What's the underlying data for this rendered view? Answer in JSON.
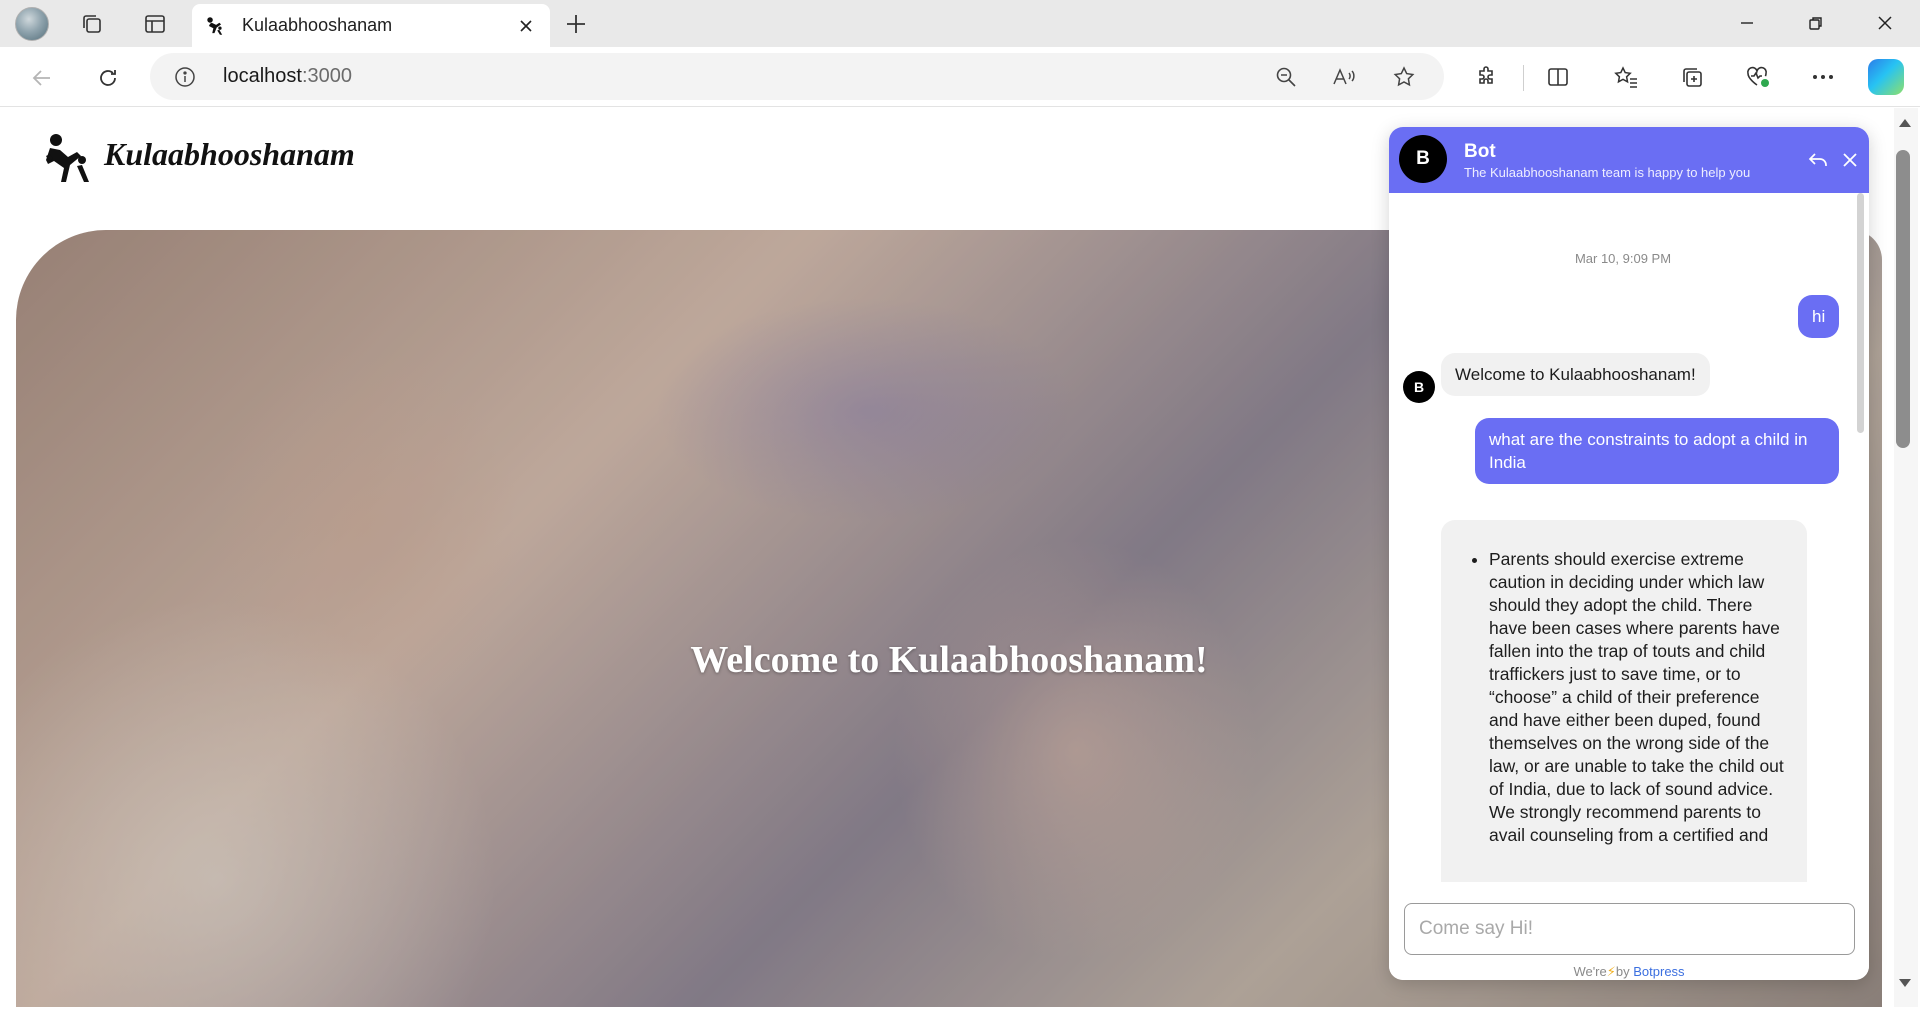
{
  "browser": {
    "tab_title": "Kulaabhooshanam",
    "url_host": "localhost",
    "url_port": ":3000"
  },
  "site": {
    "title": "Kulaabhooshanam",
    "hero_heading": "Welcome to Kulaabhooshanam!"
  },
  "chat": {
    "bot_initial": "B",
    "bot_name": "Bot",
    "bot_description": "The Kulaabhooshanam team is happy to help you",
    "timestamp": "Mar 10, 9:09 PM",
    "messages": [
      {
        "from": "user",
        "text": "hi"
      },
      {
        "from": "bot",
        "text": "Welcome to Kulaabhooshanam!"
      },
      {
        "from": "user",
        "text": "what are the constraints to adopt a child in India"
      },
      {
        "from": "bot",
        "text": "Parents should exercise extreme caution in deciding under which law should they adopt the child. There have been cases where parents have fallen into the trap of touts and child traffickers just to save time, or to “choose” a child of their preference and have either been duped, found themselves on the wrong side of the law, or are unable to take the child out of India, due to lack of sound advice. We strongly recommend parents to avail counseling from a certified and"
      }
    ],
    "composer_placeholder": "Come say Hi!",
    "powered_prefix": "We're",
    "powered_by": "by",
    "powered_brand": "Botpress"
  },
  "colors": {
    "chat_accent": "#6a6ef3",
    "brand_link": "#3b6fe0"
  }
}
